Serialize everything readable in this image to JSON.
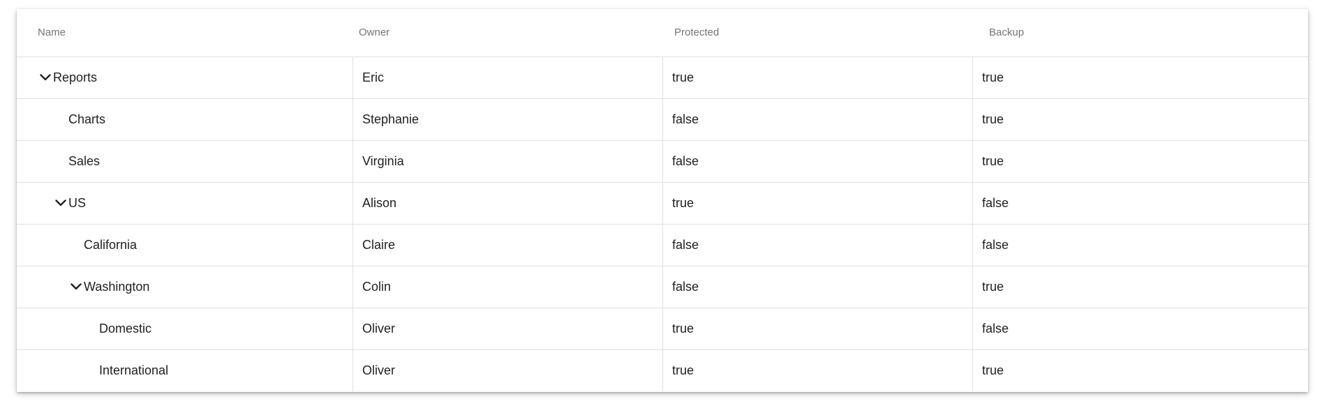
{
  "columns": {
    "name": "Name",
    "owner": "Owner",
    "protected": "Protected",
    "backup": "Backup"
  },
  "rows": [
    {
      "name": "Reports",
      "owner": "Eric",
      "protected": "true",
      "backup": "true",
      "level": 0,
      "expandable": true,
      "expanded": true
    },
    {
      "name": "Charts",
      "owner": "Stephanie",
      "protected": "false",
      "backup": "true",
      "level": 1,
      "expandable": false
    },
    {
      "name": "Sales",
      "owner": "Virginia",
      "protected": "false",
      "backup": "true",
      "level": 1,
      "expandable": false
    },
    {
      "name": "US",
      "owner": "Alison",
      "protected": "true",
      "backup": "false",
      "level": 1,
      "expandable": true,
      "expanded": true
    },
    {
      "name": "California",
      "owner": "Claire",
      "protected": "false",
      "backup": "false",
      "level": 2,
      "expandable": false
    },
    {
      "name": "Washington",
      "owner": "Colin",
      "protected": "false",
      "backup": "true",
      "level": 2,
      "expandable": true,
      "expanded": true
    },
    {
      "name": "Domestic",
      "owner": "Oliver",
      "protected": "true",
      "backup": "false",
      "level": 3,
      "expandable": false
    },
    {
      "name": "International",
      "owner": "Oliver",
      "protected": "true",
      "backup": "true",
      "level": 3,
      "expandable": false
    }
  ],
  "icons": {
    "expanded": "chevron-down-icon"
  }
}
